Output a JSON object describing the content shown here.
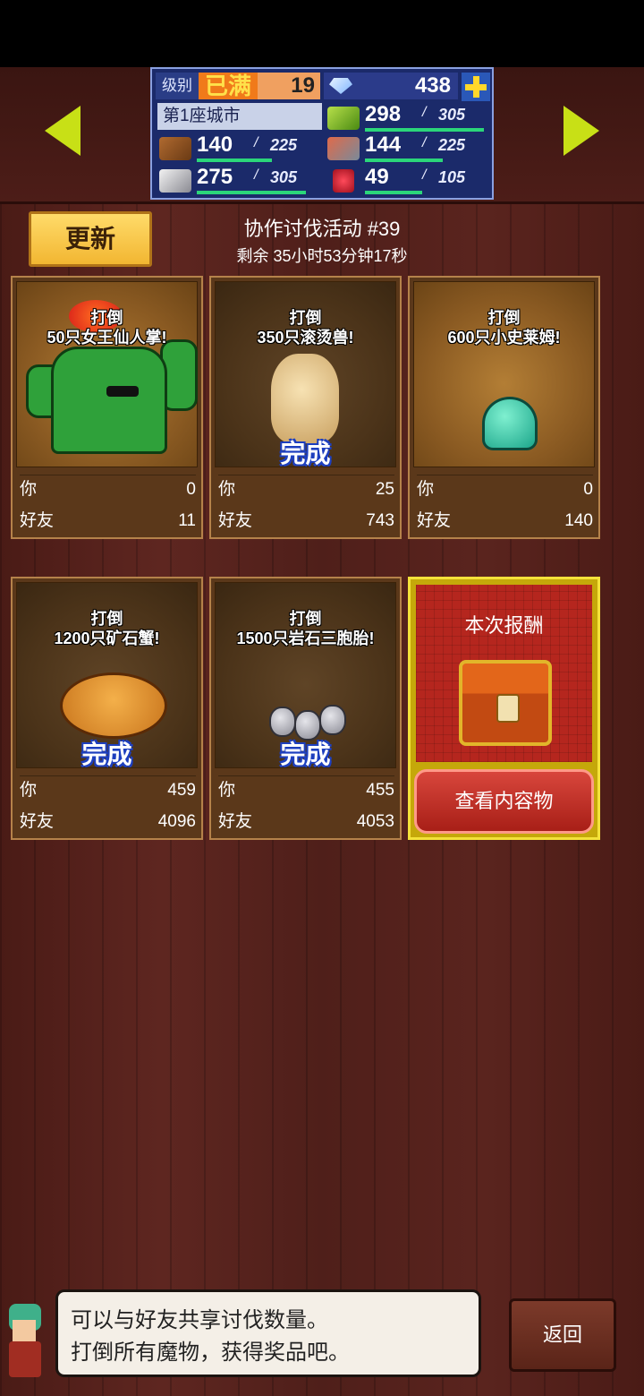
{
  "status": {
    "level_label": "级别",
    "level_max_text": "已满",
    "level_value": "19",
    "gems": "438",
    "city": "第1座城市",
    "resources": [
      {
        "icon": "wood-log-icon",
        "current": "140",
        "max": "225",
        "fill": 0.62
      },
      {
        "icon": "grass-crop-icon",
        "current": "298",
        "max": "305",
        "fill": 0.98
      },
      {
        "icon": "food-icon",
        "current": "144",
        "max": "225",
        "fill": 0.64
      },
      {
        "icon": "stone-ore-icon",
        "current": "275",
        "max": "305",
        "fill": 0.9
      },
      {
        "icon": "ruby-gem-icon",
        "current": "49",
        "max": "105",
        "fill": 0.47
      }
    ],
    "separator": "/"
  },
  "event": {
    "refresh_label": "更新",
    "title": "协作讨伐活动 #39",
    "remaining": "剩余 35小时53分钟17秒"
  },
  "labels": {
    "you": "你",
    "friend": "好友",
    "defeat": "打倒",
    "complete": "完成"
  },
  "cards": [
    {
      "goal": "50只女王仙人掌!",
      "you": "0",
      "friend": "11",
      "done": false
    },
    {
      "goal": "350只滚烫兽!",
      "you": "25",
      "friend": "743",
      "done": true
    },
    {
      "goal": "600只小史莱姆!",
      "you": "0",
      "friend": "140",
      "done": false
    },
    {
      "goal": "1200只矿石蟹!",
      "you": "459",
      "friend": "4096",
      "done": true
    },
    {
      "goal": "1500只岩石三胞胎!",
      "you": "455",
      "friend": "4053",
      "done": true
    }
  ],
  "reward": {
    "title": "本次报酬",
    "view_button": "查看内容物"
  },
  "dialog": {
    "line1": "可以与好友共享讨伐数量。",
    "line2": "打倒所有魔物，获得奖品吧。"
  },
  "back_button": "返回",
  "colors": {
    "accent_green": "#c8e016",
    "complete_blue": "#1d3fbf",
    "reward_red": "#b5261e"
  }
}
